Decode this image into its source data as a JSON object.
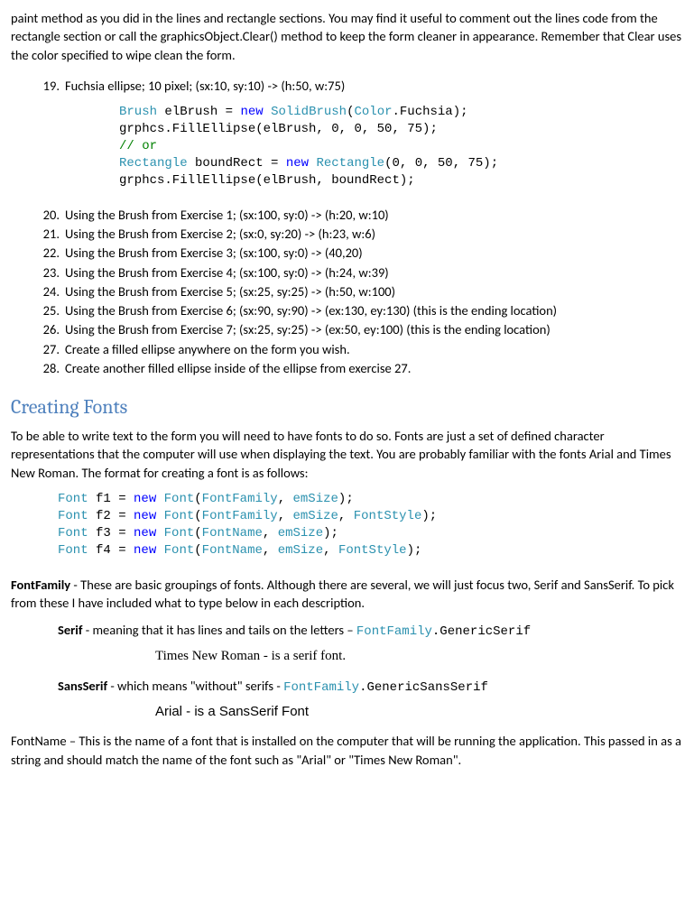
{
  "intro": "paint method as you did in the lines and rectangle sections. You may find it useful to comment out the lines code from the rectangle section or call the graphicsObject.Clear() method to keep the form cleaner in appearance. Remember that Clear uses the color specified to wipe clean the form.",
  "ex19": {
    "num": "19.",
    "txt": "Fuchsia ellipse; 10 pixel; (sx:10, sy:10) -> (h:50, w:75)"
  },
  "code1": {
    "l1a": "Brush",
    "l1b": " elBrush = ",
    "l1c": "new",
    "l1d": " ",
    "l1e": "SolidBrush",
    "l1f": "(",
    "l1g": "Color",
    "l1h": ".Fuchsia);",
    "l2": "grphcs.FillEllipse(elBrush, 0, 0, 50, 75);",
    "l3": "// or",
    "l4a": "Rectangle",
    "l4b": " boundRect = ",
    "l4c": "new",
    "l4d": " ",
    "l4e": "Rectangle",
    "l4f": "(0, 0, 50, 75);",
    "l5": "grphcs.FillEllipse(elBrush, boundRect);"
  },
  "exlist": [
    {
      "num": "20.",
      "txt": "Using the Brush from Exercise 1; (sx:100, sy:0) -> (h:20, w:10)"
    },
    {
      "num": "21.",
      "txt": "Using the Brush from Exercise 2; (sx:0, sy:20) -> (h:23, w:6)"
    },
    {
      "num": "22.",
      "txt": "Using the Brush from Exercise 3; (sx:100, sy:0) -> (40,20)"
    },
    {
      "num": "23.",
      "txt": "Using the Brush from Exercise 4; (sx:100, sy:0) -> (h:24, w:39)"
    },
    {
      "num": "24.",
      "txt": "Using the Brush from Exercise 5; (sx:25, sy:25) -> (h:50, w:100)"
    },
    {
      "num": "25.",
      "txt": "Using the Brush from Exercise 6; (sx:90, sy:90) -> (ex:130, ey:130) (this is the ending location)"
    },
    {
      "num": "26.",
      "txt": "Using the Brush from Exercise 7; (sx:25, sy:25) -> (ex:50, ey:100) (this is the ending location)"
    },
    {
      "num": "27.",
      "txt": "Create a filled ellipse anywhere on the form you wish."
    },
    {
      "num": "28.",
      "txt": "Create another filled ellipse inside of the ellipse from exercise 27."
    }
  ],
  "heading1": "Creating Fonts",
  "fonts_intro": "To be able to write text to the form you will need to have fonts to do so. Fonts are just a set of defined character representations that the computer will use when displaying the text. You are probably familiar with the fonts Arial and Times New Roman. The format for creating a font is as follows:",
  "code2": {
    "r1": {
      "a": "Font",
      "b": " f1 = ",
      "c": "new",
      "d": " ",
      "e": "Font",
      "f": "(",
      "g": "FontFamily",
      "h": ", ",
      "i": "emSize",
      "j": ");"
    },
    "r2": {
      "a": "Font",
      "b": " f2 = ",
      "c": "new",
      "d": " ",
      "e": "Font",
      "f": "(",
      "g": "FontFamily",
      "h": ", ",
      "i": "emSize",
      "j": ", ",
      "k": "FontStyle",
      "l": ");"
    },
    "r3": {
      "a": "Font",
      "b": " f3 = ",
      "c": "new",
      "d": " ",
      "e": "Font",
      "f": "(",
      "g": "FontName",
      "h": ", ",
      "i": "emSize",
      "j": ");"
    },
    "r4": {
      "a": "Font",
      "b": " f4 = ",
      "c": "new",
      "d": " ",
      "e": "Font",
      "f": "(",
      "g": "FontName",
      "h": ", ",
      "i": "emSize",
      "j": ", ",
      "k": "FontStyle",
      "l": ");"
    }
  },
  "fontfamily_label": "FontFamily",
  "fontfamily_txt": " - These are basic groupings of fonts. Although there are several, we will just focus two, Serif and SansSerif. To pick from these I have included what to type below in each description.",
  "serif_label": "Serif",
  "serif_txt": " - meaning that it has lines and tails on the letters – ",
  "serif_code_a": "FontFamily",
  "serif_code_b": ".GenericSerif",
  "serif_sample": "Times New Roman - is a serif font.",
  "sans_label": "SansSerif",
  "sans_txt": " - which means \"without\" serifs - ",
  "sans_code_a": "FontFamily",
  "sans_code_b": ".GenericSansSerif",
  "sans_sample": "Arial - is a SansSerif Font",
  "fontname_label": "FontName",
  "fontname_txt": " – This is the name of a font that is installed on the computer that will be running the application. This passed in as a string and should match the name of the font such as \"Arial\" or \"Times New Roman\"."
}
